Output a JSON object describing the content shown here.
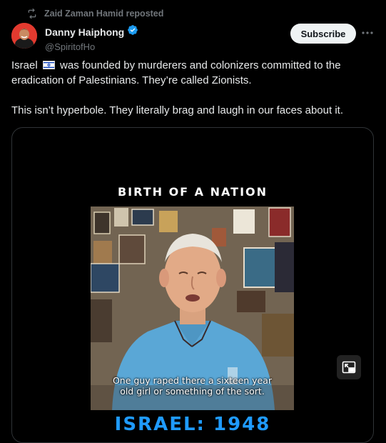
{
  "repost": {
    "text": "Zaid Zaman Hamid reposted",
    "icon": "repost-icon"
  },
  "author": {
    "name": "Danny Haiphong",
    "handle": "@SpiritofHo",
    "verified": true,
    "verified_color": "#1d9bf0"
  },
  "actions": {
    "subscribe_label": "Subscribe",
    "more_icon": "more-icon"
  },
  "tweet": {
    "line1_before_flag": "Israel",
    "line1_after_flag": "was founded by murderers and colonizers committed to the eradication of Palestinians. They’re called Zionists.",
    "line2": "This isn’t hyperbole. They literally brag and laugh in our faces about it."
  },
  "video": {
    "title": "BIRTH OF A NATION",
    "caption_line1": "One guy raped there a sixteen year",
    "caption_line2": "old girl or something of the sort.",
    "banner": "ISRAEL: 1948",
    "banner_color": "#1f9bff"
  }
}
